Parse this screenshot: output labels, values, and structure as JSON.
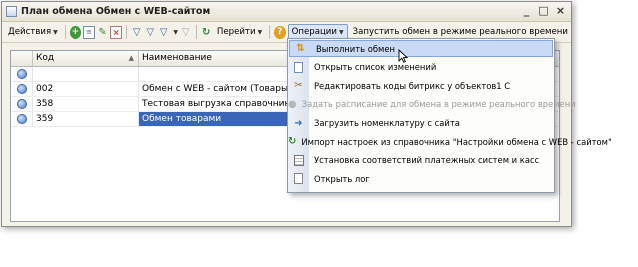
{
  "window": {
    "title": "План обмена Обмен с WEB-сайтом",
    "controls": [
      "_",
      "□",
      "×"
    ]
  },
  "toolbar": {
    "actions_label": "Действия",
    "goto_label": "Перейти",
    "operations_label": "Операции",
    "realtime_label": "Запустить обмен в режиме реального времени"
  },
  "grid": {
    "columns": [
      "Код",
      "Наименование"
    ],
    "rows": [
      {
        "code": "",
        "name": ""
      },
      {
        "code": "002",
        "name": "Обмен с WEB - сайтом (Товары и Заказ"
      },
      {
        "code": "358",
        "name": "Тестовая выгрузка справочников"
      },
      {
        "code": "359",
        "name": "Обмен товарами"
      }
    ]
  },
  "menu": {
    "items": [
      {
        "label": "Выполнить обмен",
        "icon": "run-exchange-icon"
      },
      {
        "label": "Открыть список изменений",
        "icon": "changes-list-icon"
      },
      {
        "label": "Редактировать коды битрикс у объектов1 С",
        "icon": "tools-icon"
      },
      {
        "label": "Задать расписание для обмена в режиме реального времени",
        "icon": "clock-icon"
      },
      {
        "label": "Загрузить номенклатуру с сайта",
        "icon": "download-icon"
      },
      {
        "label": "Импорт настроек из справочника \"Настройки обмена с WEB - сайтом\"",
        "icon": "import-icon"
      },
      {
        "label": "Установка соответствий платежных систем и касс",
        "icon": "table-icon"
      },
      {
        "label": "Открыть лог",
        "icon": "log-icon"
      }
    ]
  },
  "colors": {
    "window_bg": "#f4f2e8",
    "selection": "#3a66b8",
    "menu_hover": "#c9daf4"
  }
}
